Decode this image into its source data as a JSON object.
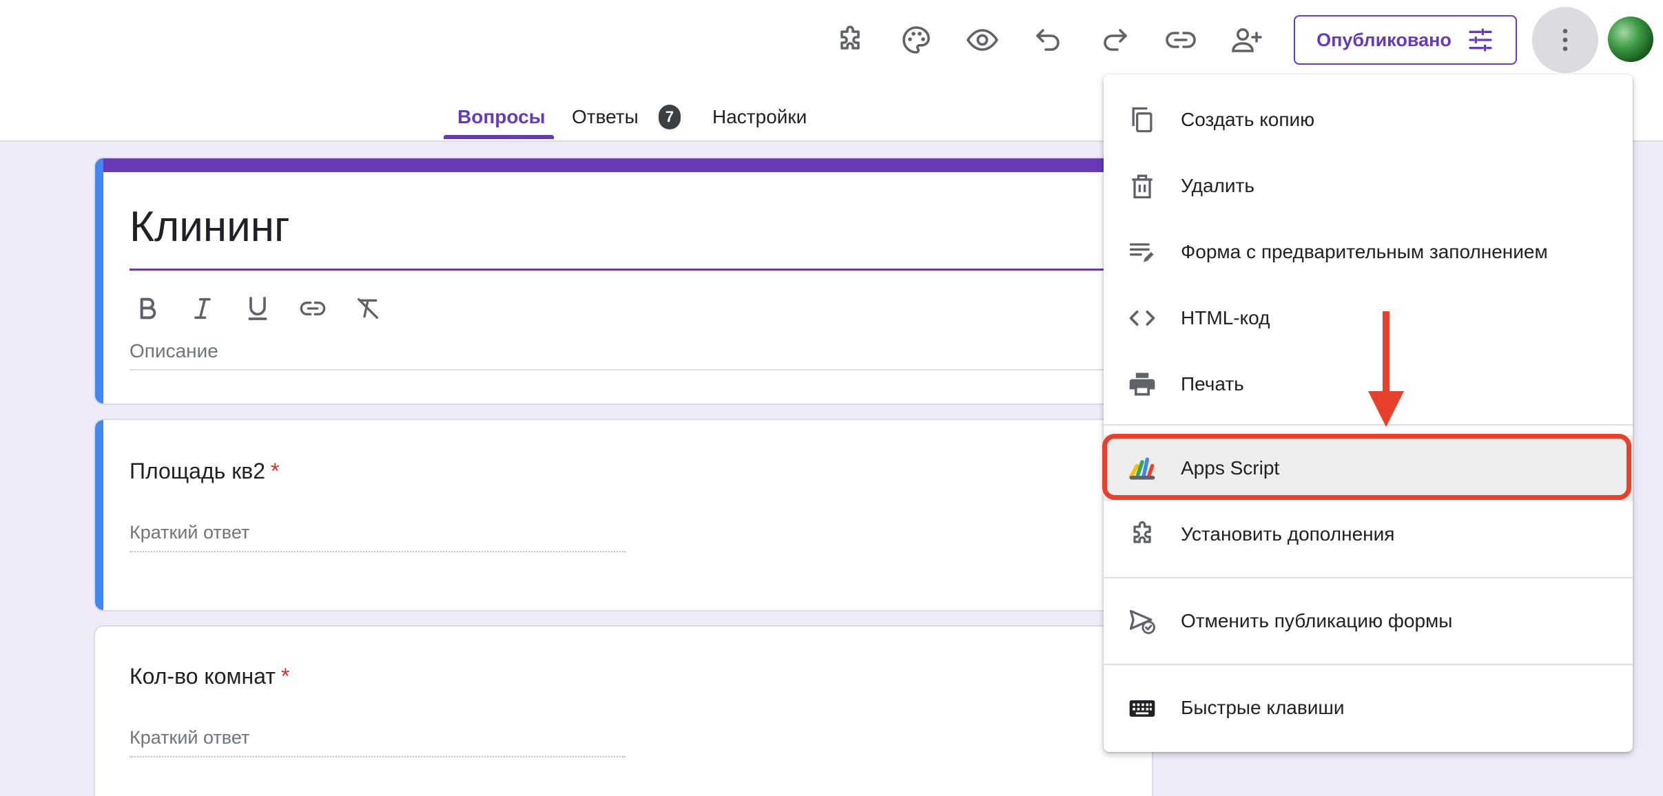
{
  "header": {
    "toolbar": [
      {
        "name": "addons",
        "icon": "puzzle-icon"
      },
      {
        "name": "theme",
        "icon": "palette-icon"
      },
      {
        "name": "preview",
        "icon": "eye-icon"
      },
      {
        "name": "undo",
        "icon": "undo-icon"
      },
      {
        "name": "redo",
        "icon": "redo-icon"
      },
      {
        "name": "link",
        "icon": "link-icon"
      },
      {
        "name": "collaborators",
        "icon": "add-person-icon"
      }
    ],
    "publish_label": "Опубликовано",
    "accent_color": "#673ab7"
  },
  "tabs": {
    "questions": "Вопросы",
    "responses": "Ответы",
    "responses_count": "7",
    "settings": "Настройки"
  },
  "form": {
    "title": "Клининг",
    "description_placeholder": "Описание",
    "questions": [
      {
        "title": "Площадь кв2",
        "required": "*",
        "answer_placeholder": "Краткий ответ"
      },
      {
        "title": "Кол-во комнат",
        "required": "*",
        "answer_placeholder": "Краткий ответ"
      }
    ]
  },
  "menu": {
    "items": [
      {
        "label": "Создать копию",
        "icon": "copy-icon"
      },
      {
        "label": "Удалить",
        "icon": "trash-icon"
      },
      {
        "label": "Форма с предварительным заполнением",
        "icon": "prefill-icon"
      },
      {
        "label": "HTML-код",
        "icon": "code-icon"
      },
      {
        "label": "Печать",
        "icon": "print-icon"
      },
      {
        "label": "Apps Script",
        "icon": "apps-script-icon"
      },
      {
        "label": "Установить дополнения",
        "icon": "puzzle-icon"
      },
      {
        "label": "Отменить публикацию формы",
        "icon": "unpublish-icon"
      },
      {
        "label": "Быстрые клавиши",
        "icon": "keyboard-icon"
      }
    ],
    "highlighted_item": "Apps Script",
    "highlight_color": "#e8402a"
  }
}
